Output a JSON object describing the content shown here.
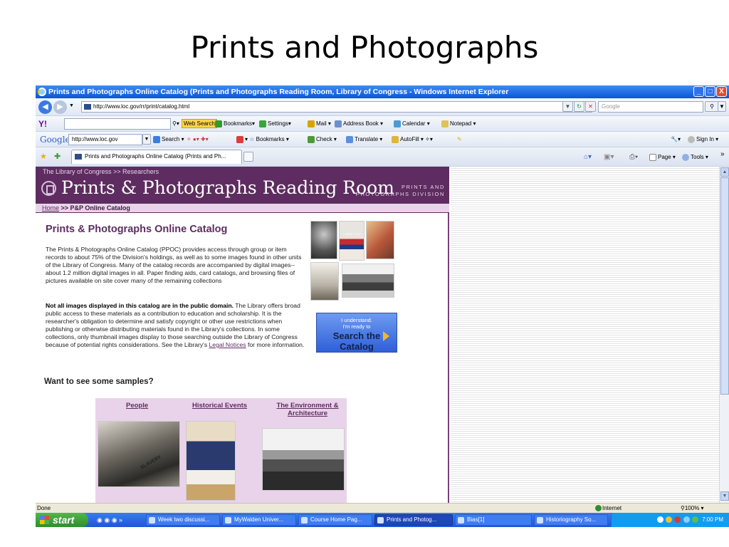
{
  "slide": {
    "title": "Prints and Photographs"
  },
  "window": {
    "title": "Prints and Photographs Online Catalog (Prints and Photographs Reading Room, Library of Congress - Windows Internet Explorer",
    "min": "_",
    "max": "□",
    "close": "X"
  },
  "address_bar": {
    "url": "http://www.loc.gov/rr/print/catalog.html",
    "search_placeholder": "Google"
  },
  "yahoo_toolbar": {
    "logo": "Y!",
    "web_search": "Web Search",
    "bookmarks": "Bookmarks",
    "settings": "Settings",
    "mail": "Mail",
    "address_book": "Address Book",
    "calendar": "Calendar",
    "notepad": "Notepad"
  },
  "google_toolbar": {
    "logo": "Google",
    "query": "http://www.loc.gov",
    "search": "Search",
    "bookmarks": "Bookmarks",
    "check": "Check",
    "translate": "Translate",
    "autofill": "AutoFill",
    "sign_in": "Sign In"
  },
  "tabs_bar": {
    "tab_label": "Prints and Photographs Online Catalog (Prints and Ph...",
    "page_menu": "Page",
    "tools_menu": "Tools",
    "more": "»"
  },
  "page": {
    "top_crumb": "The Library of Congress >> Researchers",
    "banner_title": "Prints & Photographs Reading Room",
    "division_line1": "PRINTS AND",
    "division_line2": "PHOTOGRAPHS DIVISION",
    "crumb_home": "Home",
    "crumb_rest": " >> P&P Online Catalog",
    "heading": "Prints & Photographs Online Catalog",
    "para1": "The Prints & Photographs Online Catalog (PPOC) provides access through group or item records to about 75% of the Division's holdings, as well as to some images found in other units of the Library of Congress. Many of the catalog records are accompanied by digital images--about 1.2 million digital images in all. Paper finding aids, card catalogs, and browsing files of pictures available on site cover many of the remaining collections",
    "para2_bold": "Not all images displayed in this catalog are in the public domain.",
    "para2_text": " The Library offers broad public access to these materials as a contribution to education and scholarship. It is the researcher's obligation to determine and satisfy copyright or other use restrictions when publishing or otherwise distributing materials found in the Library's collections. In some collections, only thumbnail images display to those searching outside the Library of Congress because of potential rights considerations. See the Library's ",
    "para2_link": "Legal Notices",
    "para2_end": " for more information.",
    "cta_line1": "I understand.",
    "cta_line2": "I'm ready to",
    "cta_line3": "Search the",
    "cta_line4": "Catalog",
    "poster_text": "I WANT YOU",
    "samples_heading": "Want to see some samples?",
    "sample_people": "People",
    "sample_events": "Historical Events",
    "sample_env_1": "The Environment &",
    "sample_env_2": "Architecture",
    "sash_text": "SLAVERY"
  },
  "status_bar": {
    "text": "Done",
    "zone": "Internet",
    "zoom": "100%"
  },
  "taskbar": {
    "start": "start",
    "tasks": [
      "Week two discussi...",
      "MyWalden Univer...",
      "Course Home Pag...",
      "Prints and Photog...",
      "Bias[1]",
      "Historiography So..."
    ],
    "clock": "7:00 PM"
  },
  "colors": {
    "accent": "#5e2c60",
    "xp_blue": "#0a55d8",
    "start_green": "#3a9b35"
  }
}
